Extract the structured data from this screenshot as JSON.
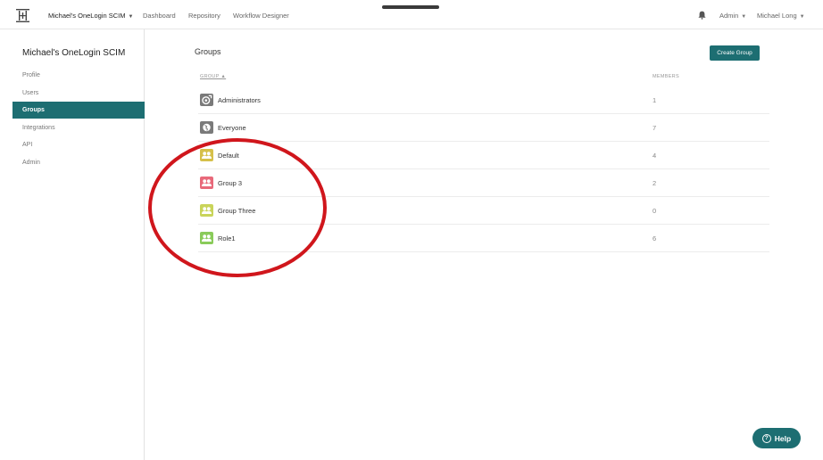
{
  "topbar": {
    "org_name": "Michael's OneLogin SCIM",
    "nav": [
      "Dashboard",
      "Repository",
      "Workflow Designer"
    ],
    "admin_label": "Admin",
    "user_label": "Michael Long"
  },
  "sidebar": {
    "title": "Michael's OneLogin SCIM",
    "items": [
      {
        "label": "Profile",
        "active": false
      },
      {
        "label": "Users",
        "active": false
      },
      {
        "label": "Groups",
        "active": true
      },
      {
        "label": "Integrations",
        "active": false
      },
      {
        "label": "API",
        "active": false
      },
      {
        "label": "Admin",
        "active": false
      }
    ]
  },
  "main": {
    "title": "Groups",
    "create_button": "Create Group",
    "columns": {
      "group": "GROUP ▲",
      "members": "MEMBERS"
    },
    "groups": [
      {
        "name": "Administrators",
        "members": "1",
        "icon": "admin-group-icon",
        "color": "#7a7a7a"
      },
      {
        "name": "Everyone",
        "members": "7",
        "icon": "globe-icon",
        "color": "#7a7a7a"
      },
      {
        "name": "Default",
        "members": "4",
        "icon": "people-icon",
        "color": "#d6c04a"
      },
      {
        "name": "Group 3",
        "members": "2",
        "icon": "people-icon",
        "color": "#e8697a"
      },
      {
        "name": "Group Three",
        "members": "0",
        "icon": "people-icon",
        "color": "#c9d45a"
      },
      {
        "name": "Role1",
        "members": "6",
        "icon": "people-icon",
        "color": "#8acb5a"
      }
    ]
  },
  "annotation_color": "#d0161c",
  "help": {
    "label": "Help"
  },
  "accent_color": "#1d6e72"
}
